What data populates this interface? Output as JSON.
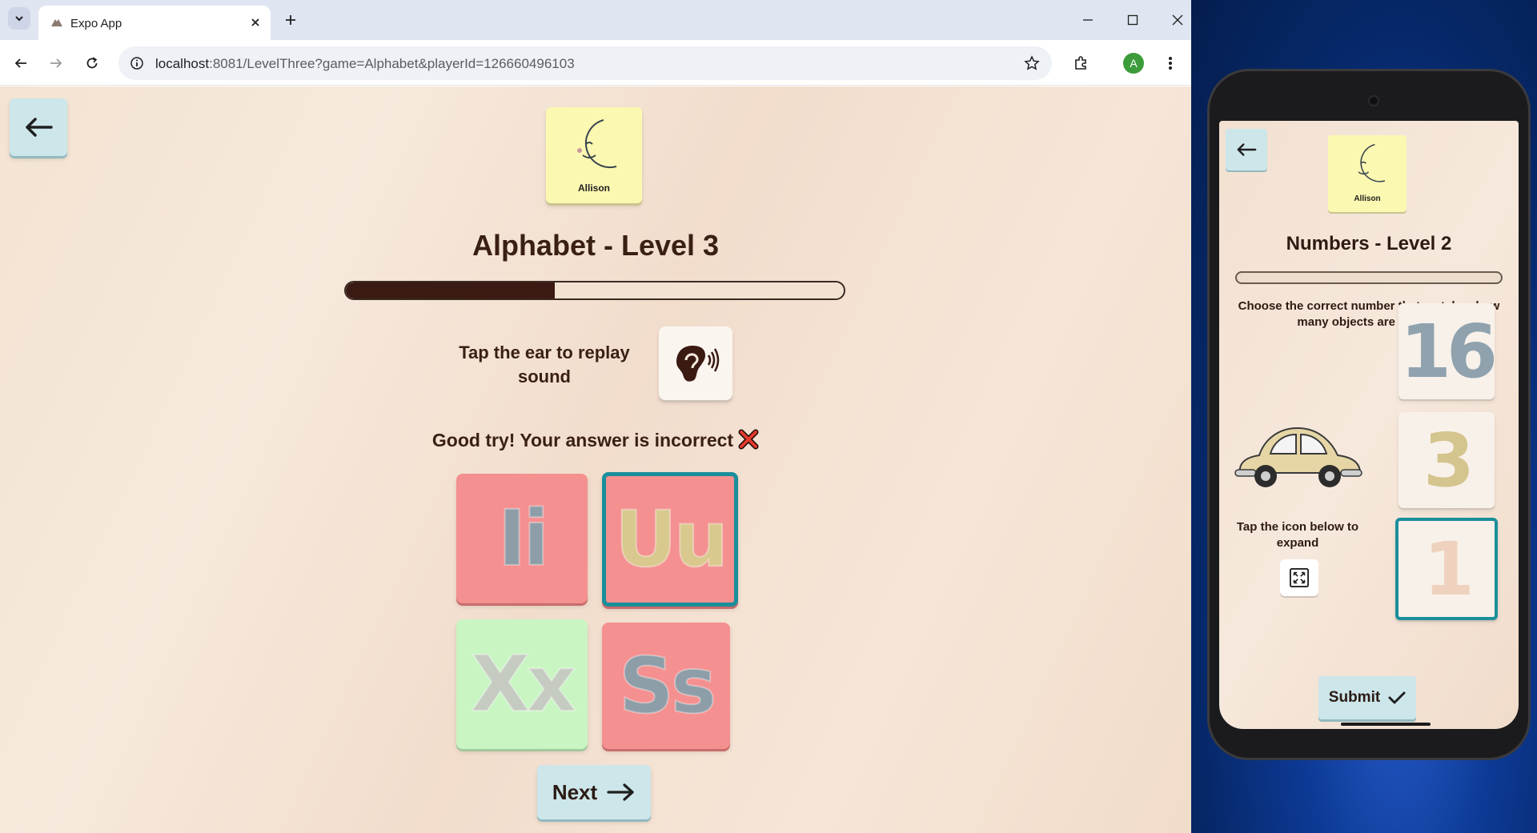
{
  "browser": {
    "tab_title": "Expo App",
    "url_host": "localhost",
    "url_rest": ":8081/LevelThree?game=Alphabet&playerId=126660496103",
    "profile_initial": "A"
  },
  "app": {
    "profile_name": "Allison",
    "level_title": "Alphabet - Level 3",
    "progress": 0.42,
    "replay_hint": "Tap the ear to replay sound",
    "feedback": "Good try! Your answer is incorrect",
    "tiles": [
      {
        "text": "Ii",
        "color": "#8e9ea8",
        "bg": "red"
      },
      {
        "text": "Uu",
        "color": "#d9c98f",
        "bg": "red",
        "selected": true
      },
      {
        "text": "Xx",
        "color": "#c5cbc1",
        "bg": "green"
      },
      {
        "text": "Ss",
        "color": "#8e9ea8",
        "bg": "red"
      }
    ],
    "next_label": "Next"
  },
  "phone": {
    "profile_name": "Allison",
    "level_title": "Numbers - Level 2",
    "progress": 0.0,
    "instruction": "Choose the correct number that matches how many objects are shown:",
    "expand_hint": "Tap the icon below to expand",
    "numbers": [
      {
        "text": "16",
        "color": "#8fa2ae"
      },
      {
        "text": "3",
        "color": "#d4c58e"
      },
      {
        "text": "1",
        "color": "#efd2bd",
        "selected": true
      }
    ],
    "submit_label": "Submit"
  },
  "colors": {
    "accent_teal": "#1a8f9b",
    "button_bg": "#cde6ea",
    "title_brown": "#3a1f14",
    "tile_red": "#f49090",
    "tile_green": "#c9f5c3",
    "profile_yellow": "#fbf8b1"
  }
}
